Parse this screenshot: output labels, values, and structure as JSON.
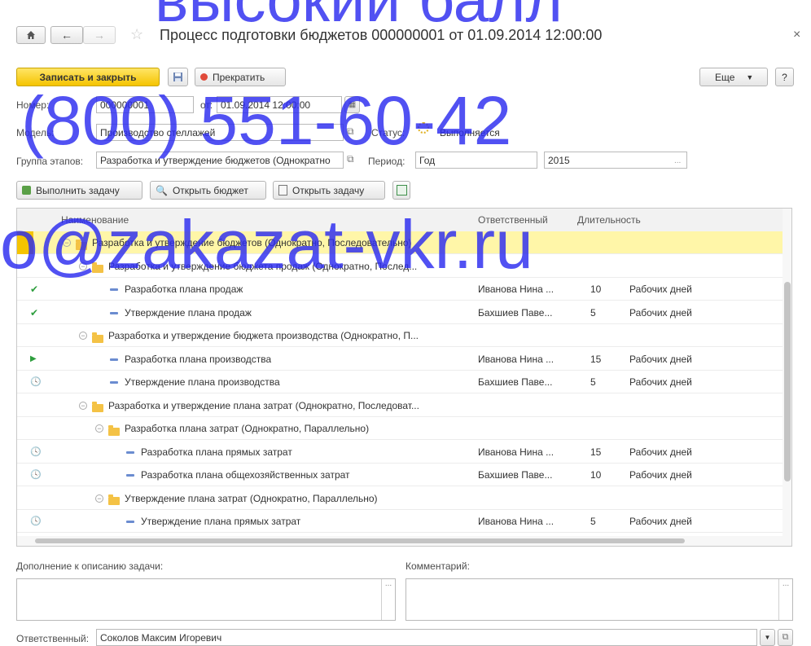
{
  "header": {
    "title": "Процесс подготовки бюджетов 000000001 от 01.09.2014 12:00:00",
    "close": "×"
  },
  "toolbar": {
    "save_close": "Записать и закрыть",
    "stop": "Прекратить",
    "more": "Еще",
    "help": "?"
  },
  "form": {
    "number_label": "Номер:",
    "number_value": "000000001",
    "date_label": "от:",
    "date_value": "01.09.2014 12:00:00",
    "model_label": "Модель:",
    "model_value": "Производство стеллажей",
    "status_label": "Статус:",
    "status_value": "Выполняется",
    "stage_group_label": "Группа этапов:",
    "stage_group_value": "Разработка и утверждение бюджетов (Однократно",
    "period_label": "Период:",
    "period_type": "Год",
    "period_value": "2015"
  },
  "actions": {
    "execute": "Выполнить задачу",
    "open_budget": "Открыть бюджет",
    "open_task": "Открыть задачу"
  },
  "table": {
    "columns": [
      "Наименование",
      "Ответственный",
      "Длительность"
    ],
    "rows": [
      {
        "state": "",
        "name": "Разработка и утверждение бюджетов (Однократно, Последовательно)",
        "resp": "",
        "dur": "",
        "unit": ""
      },
      {
        "state": "",
        "name": "Разработка и утверждение бюджета продаж (Однократно, Послед...",
        "resp": "",
        "dur": "",
        "unit": ""
      },
      {
        "state": "done",
        "name": "Разработка плана продаж",
        "resp": "Иванова Нина ...",
        "dur": "10",
        "unit": "Рабочих дней"
      },
      {
        "state": "done",
        "name": "Утверждение плана продаж",
        "resp": "Бахшиев Паве...",
        "dur": "5",
        "unit": "Рабочих дней"
      },
      {
        "state": "",
        "name": "Разработка и утверждение бюджета производства (Однократно, П...",
        "resp": "",
        "dur": "",
        "unit": ""
      },
      {
        "state": "running",
        "name": "Разработка плана производства",
        "resp": "Иванова Нина ...",
        "dur": "15",
        "unit": "Рабочих дней"
      },
      {
        "state": "waiting",
        "name": "Утверждение плана производства",
        "resp": "Бахшиев Паве...",
        "dur": "5",
        "unit": "Рабочих дней"
      },
      {
        "state": "",
        "name": "Разработка и утверждение плана затрат (Однократно, Последоват...",
        "resp": "",
        "dur": "",
        "unit": ""
      },
      {
        "state": "",
        "name": "Разработка плана затрат (Однократно, Параллельно)",
        "resp": "",
        "dur": "",
        "unit": ""
      },
      {
        "state": "waiting",
        "name": "Разработка плана прямых затрат",
        "resp": "Иванова Нина ...",
        "dur": "15",
        "unit": "Рабочих дней"
      },
      {
        "state": "waiting",
        "name": "Разработка плана общехозяйственных затрат",
        "resp": "Бахшиев Паве...",
        "dur": "10",
        "unit": "Рабочих дней"
      },
      {
        "state": "",
        "name": "Утверждение плана затрат (Однократно, Параллельно)",
        "resp": "",
        "dur": "",
        "unit": ""
      },
      {
        "state": "waiting",
        "name": "Утверждение плана прямых затрат",
        "resp": "Иванова Нина ...",
        "dur": "5",
        "unit": "Рабочих дней"
      }
    ]
  },
  "bottom": {
    "addition_label": "Дополнение к описанию задачи:",
    "comment_label": "Комментарий:",
    "responsible_label": "Ответственный:",
    "responsible_value": "Соколов Максим Игоревич"
  },
  "watermark": {
    "line1": "высокий балл",
    "line2": "(800) 551-60-42",
    "line3": "o@zakazat-vkr.ru"
  },
  "colors": {
    "accent_yellow": "#f5c400",
    "selected_row": "#fff6a8",
    "done_green": "#2e9e3e",
    "watermark_blue": "#2b2bf0"
  }
}
